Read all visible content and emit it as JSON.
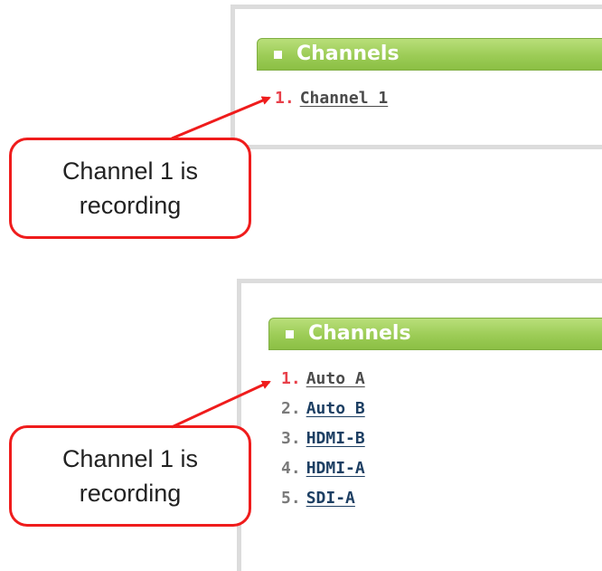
{
  "top_panel": {
    "title": "Channels",
    "channels": [
      {
        "number": "1.",
        "name": "Channel 1"
      }
    ]
  },
  "bottom_panel": {
    "title": "Channels",
    "channels": [
      {
        "number": "1.",
        "name": "Auto A"
      },
      {
        "number": "2.",
        "name": "Auto B"
      },
      {
        "number": "3.",
        "name": "HDMI-B"
      },
      {
        "number": "4.",
        "name": "HDMI-A"
      },
      {
        "number": "5.",
        "name": "SDI-A"
      }
    ]
  },
  "callouts": {
    "top": "Channel 1 is recording",
    "bottom": "Channel 1 is recording"
  },
  "colors": {
    "recording_number": "#e8404a",
    "header_green": "#9ccc56",
    "callout_border": "#ef1c1c",
    "link": "#1d3f63"
  }
}
